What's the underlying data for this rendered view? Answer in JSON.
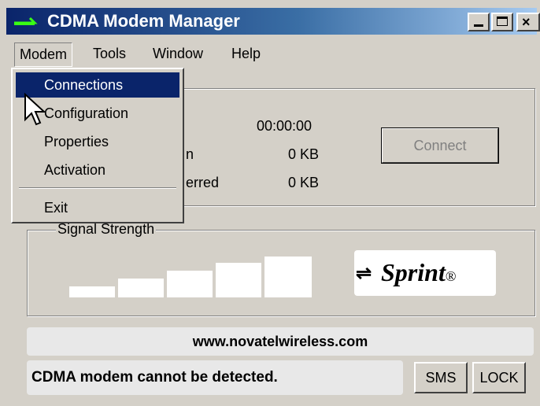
{
  "window": {
    "title": "CDMA Modem Manager",
    "controls": {
      "minimize": "_",
      "maximize": "□",
      "close": "×"
    }
  },
  "menubar": {
    "items": [
      "Modem",
      "Tools",
      "Window",
      "Help"
    ]
  },
  "modem_menu": {
    "items": [
      "Connections",
      "Configuration",
      "Properties",
      "Activation"
    ],
    "exit": "Exit",
    "selected": "Connections"
  },
  "connection": {
    "time_value": "00:00:00",
    "received_label_fragment": "n",
    "received_value": "0 KB",
    "transferred_label_fragment": "erred",
    "transferred_value": "0 KB",
    "connect_button": "Connect"
  },
  "signal": {
    "label": "Signal Strength",
    "bars_total": 5
  },
  "brand": {
    "logo_text": "Sprint",
    "logo_mark": "®"
  },
  "footer": {
    "url": "www.novatelwireless.com",
    "status": "CDMA modem cannot be detected.",
    "sms_button": "SMS",
    "lock_button": "LOCK"
  },
  "colors": {
    "title_bar": "#0a246a",
    "menu_selection": "#0a246a",
    "window_face": "#d4d0c8",
    "app_icon": "#39ff14"
  },
  "icons": {
    "app": "modem-icon",
    "cursor": "arrow-cursor-icon"
  }
}
